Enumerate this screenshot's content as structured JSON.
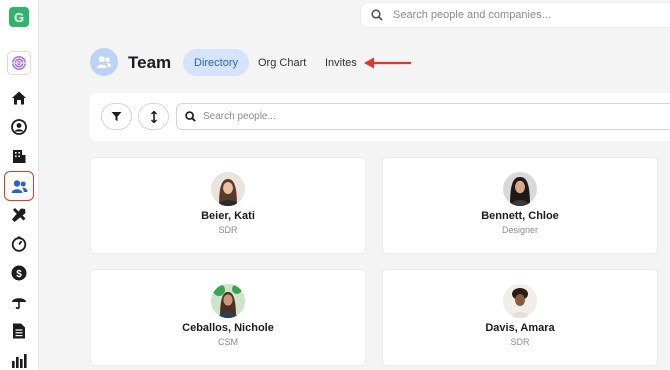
{
  "app": {
    "logo_letter": "G",
    "brand_color": "#2fb36d",
    "accent_color": "#2a62c9",
    "highlight_color": "#e0382b"
  },
  "sidebar": {
    "items": [
      {
        "icon": "home-icon"
      },
      {
        "icon": "user-circle-icon"
      },
      {
        "icon": "building-icon"
      },
      {
        "icon": "team-icon",
        "active": true
      },
      {
        "icon": "tools-icon"
      },
      {
        "icon": "gauge-icon"
      },
      {
        "icon": "dollar-icon"
      },
      {
        "icon": "umbrella-icon"
      },
      {
        "icon": "document-icon"
      },
      {
        "icon": "bar-chart-icon"
      }
    ]
  },
  "search": {
    "placeholder": "Search people and companies..."
  },
  "header": {
    "title": "Team",
    "tabs": [
      {
        "label": "Directory",
        "active": true
      },
      {
        "label": "Org Chart",
        "active": false
      },
      {
        "label": "Invites",
        "active": false
      }
    ]
  },
  "filters": {
    "people_placeholder": "Search people..."
  },
  "people": [
    {
      "name": "Beier, Kati",
      "role": "SDR"
    },
    {
      "name": "Bennett, Chloe",
      "role": "Designer"
    },
    {
      "name": "Ceballos, Nichole",
      "role": "CSM"
    },
    {
      "name": "Davis, Amara",
      "role": "SDR"
    }
  ]
}
